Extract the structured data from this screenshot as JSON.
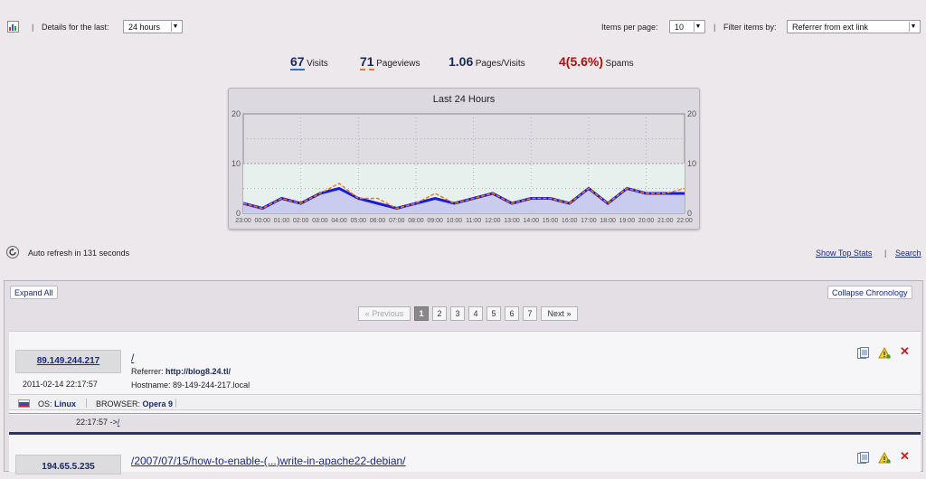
{
  "toolbar": {
    "details_label": "Details for the last:",
    "details_value": "24 hours",
    "items_per_page_label": "Items per page:",
    "items_per_page_value": "10",
    "filter_label": "Filter items by:",
    "filter_value": "Referrer from ext link",
    "separator": "|"
  },
  "stats": {
    "visits_num": "67",
    "visits_label": "Visits",
    "pageviews_num": "71",
    "pageviews_label": "Pageviews",
    "ppv_num": "1.06",
    "ppv_label": "Pages/Visits",
    "spams_num": "4(5.6%)",
    "spams_label": "Spams"
  },
  "chart_data": {
    "type": "line",
    "title": "Last 24 Hours",
    "categories": [
      "23:00",
      "00:00",
      "01:00",
      "02:00",
      "03:00",
      "04:00",
      "05:00",
      "06:00",
      "07:00",
      "08:00",
      "09:00",
      "10:00",
      "11:00",
      "12:00",
      "13:00",
      "14:00",
      "15:00",
      "16:00",
      "17:00",
      "18:00",
      "19:00",
      "20:00",
      "21:00",
      "22:00"
    ],
    "ylim": [
      0,
      20
    ],
    "yticks": [
      "0",
      "10",
      "20"
    ],
    "series": [
      {
        "values": [
          2,
          1,
          3,
          2,
          4,
          5,
          3,
          2,
          1,
          2,
          3,
          2,
          3,
          4,
          2,
          3,
          3,
          2,
          5,
          2,
          5,
          4,
          4,
          4
        ],
        "color": "#1a1ad0"
      },
      {
        "values": [
          2,
          1,
          3,
          2,
          4,
          6,
          3,
          3,
          1,
          2,
          4,
          2,
          3,
          4,
          2,
          3,
          3,
          2,
          5,
          2,
          5,
          4,
          4,
          5
        ],
        "color": "#f07a20"
      }
    ],
    "grid": true
  },
  "refresh": {
    "prefix": "Auto refresh in",
    "seconds": "131",
    "suffix": "seconds"
  },
  "links": {
    "show_top_stats": "Show Top Stats",
    "separator": "|",
    "search": "Search"
  },
  "panel": {
    "expand_all": "Expand All",
    "collapse_chronology": "Collapse Chronology"
  },
  "pager": {
    "previous": "« Previous",
    "pages": [
      "1",
      "2",
      "3",
      "4",
      "5",
      "6",
      "7"
    ],
    "current": "1",
    "next": "Next »"
  },
  "entries": [
    {
      "ip": "89.149.244.217",
      "datetime": "2011-02-14 22:17:57",
      "path": "/",
      "referrer_label": "Referrer:",
      "referrer": "http://blog8.24.tl/",
      "hostname_label": "Hostname:",
      "hostname": "89-149-244-217.local",
      "os_label": "OS:",
      "os": "Linux",
      "browser_label": "BROWSER:",
      "browser": "Opera 9",
      "chrono_time": "22:17:57 ->",
      "chrono_path": "/"
    },
    {
      "ip": "194.65.5.235",
      "path": "/2007/07/15/how-to-enable-(...)write-in-apache22-debian/"
    }
  ]
}
